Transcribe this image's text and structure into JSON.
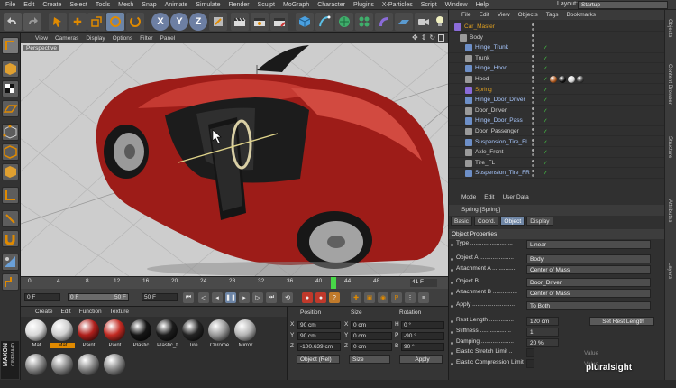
{
  "menubar": {
    "items": [
      "File",
      "Edit",
      "Create",
      "Select",
      "Tools",
      "Mesh",
      "Snap",
      "Animate",
      "Simulate",
      "Render",
      "Sculpt",
      "MoGraph",
      "Character",
      "Plugins",
      "X-Particles",
      "Script",
      "Window",
      "Help"
    ],
    "layout_label": "Layout:",
    "layout_value": "Startup"
  },
  "toolbar": {
    "icons": [
      "undo-icon",
      "redo-icon",
      "live-selection-icon",
      "move-icon",
      "scale-icon",
      "rotate-icon",
      "recent-tools-icon",
      "x-axis-icon",
      "y-axis-icon",
      "z-axis-icon",
      "world-coordinates-icon",
      "render-view-icon",
      "render-picture-viewer-icon",
      "edit-render-settings-icon",
      "cube-icon",
      "pen-spline-icon",
      "subdivision-surface-icon",
      "array-icon",
      "bend-deformer-icon",
      "floor-icon",
      "camera-icon",
      "light-icon"
    ],
    "x_label": "X",
    "y_label": "Y",
    "z_label": "Z"
  },
  "viewport": {
    "menu": [
      "View",
      "Cameras",
      "Display",
      "Options",
      "Filter",
      "Panel"
    ],
    "label": "Perspective"
  },
  "timeline": {
    "ticks": [
      "0",
      "4",
      "8",
      "12",
      "16",
      "20",
      "24",
      "28",
      "32",
      "36",
      "40",
      "44",
      "48"
    ],
    "current_frame_indicator": "41 F",
    "playhead_frame": 41
  },
  "transport": {
    "start_frame": "0 F",
    "preview_start": "0 F",
    "preview_end": "50 F",
    "end_frame": "50 F"
  },
  "materials": {
    "menu": [
      "Create",
      "Edit",
      "Function",
      "Texture"
    ],
    "items": [
      {
        "label": "Mat",
        "color": "#d8d8d8"
      },
      {
        "label": "Mat",
        "color": "#cfcfcf",
        "selected": true
      },
      {
        "label": "Paint",
        "color": "#b0201c"
      },
      {
        "label": "Paint",
        "color": "#c22a22"
      },
      {
        "label": "Plastic",
        "color": "#151515"
      },
      {
        "label": "Plastic_f",
        "color": "#1c1c1c"
      },
      {
        "label": "Tire",
        "color": "#242424"
      },
      {
        "label": "Chrome",
        "color": "#9a9a9a"
      },
      {
        "label": "Mirror",
        "color": "#b4b4b4"
      }
    ],
    "brand_top": "MAXON",
    "brand_bottom": "CINEMA4D"
  },
  "coordinates": {
    "headers": {
      "position": "Position",
      "size": "Size",
      "rotation": "Rotation"
    },
    "rows": [
      {
        "axis": "X",
        "pos": "90 cm",
        "size_axis": "X",
        "size": "0 cm",
        "rot_axis": "H",
        "rot": "0 °"
      },
      {
        "axis": "Y",
        "pos": "90 cm",
        "size_axis": "Y",
        "size": "0 cm",
        "rot_axis": "P",
        "rot": "-90 °"
      },
      {
        "axis": "Z",
        "pos": "-100.639 cm",
        "size_axis": "Z",
        "size": "0 cm",
        "rot_axis": "B",
        "rot": "90 °"
      }
    ],
    "mode_dropdown": "Object (Rel)",
    "size_dropdown": "Size",
    "apply_button": "Apply"
  },
  "objects": {
    "menu": [
      "File",
      "Edit",
      "View",
      "Objects",
      "Tags",
      "Bookmarks"
    ],
    "items": [
      {
        "name": "Car_Master",
        "indent": 0,
        "color": "#e0a020",
        "checks": false
      },
      {
        "name": "Body",
        "indent": 1,
        "color": "#cfcfcf",
        "checks": false
      },
      {
        "name": "Hinge_Trunk",
        "indent": 2,
        "color": "#a8c8ff",
        "checks": true
      },
      {
        "name": "Trunk",
        "indent": 2,
        "color": "#cfcfcf",
        "checks": true
      },
      {
        "name": "Hinge_Hood",
        "indent": 2,
        "color": "#a8c8ff",
        "checks": true
      },
      {
        "name": "Hood",
        "indent": 2,
        "color": "#cfcfcf",
        "checks": true,
        "tags": true
      },
      {
        "name": "Spring",
        "indent": 2,
        "color": "#e0a020",
        "checks": true
      },
      {
        "name": "Hinge_Door_Driver",
        "indent": 2,
        "color": "#a8c8ff",
        "checks": true
      },
      {
        "name": "Door_Driver",
        "indent": 2,
        "color": "#cfcfcf",
        "checks": true
      },
      {
        "name": "Hinge_Door_Pass",
        "indent": 2,
        "color": "#a8c8ff",
        "checks": true
      },
      {
        "name": "Door_Passenger",
        "indent": 2,
        "color": "#cfcfcf",
        "checks": true
      },
      {
        "name": "Suspension_Tire_FL",
        "indent": 2,
        "color": "#a8c8ff",
        "checks": true
      },
      {
        "name": "Axle_Front",
        "indent": 2,
        "color": "#cfcfcf",
        "checks": true
      },
      {
        "name": "Tire_FL",
        "indent": 2,
        "color": "#cfcfcf",
        "checks": true
      },
      {
        "name": "Suspension_Tire_FR",
        "indent": 2,
        "color": "#a8c8ff",
        "checks": true
      }
    ]
  },
  "attributes": {
    "menu": [
      "Mode",
      "Edit",
      "User Data"
    ],
    "title": "Spring [Spring]",
    "tabs": [
      "Basic",
      "Coord.",
      "Object",
      "Display"
    ],
    "active_tab": "Object",
    "section": "Object Properties",
    "rows": [
      {
        "label": "Type ..........................",
        "value": "Linear"
      },
      {
        "label": "Object A .....................",
        "value": "Body"
      },
      {
        "label": "Attachment A ...............",
        "value": "Center of Mass"
      },
      {
        "label": "Object B .....................",
        "value": "Door_Driver"
      },
      {
        "label": "Attachment B ...............",
        "value": "Center of Mass"
      },
      {
        "label": "Apply ..........................",
        "value": "To Both"
      },
      {
        "label": "Rest Length ...............",
        "value": "120 cm"
      },
      {
        "label": "Stiffness ...................",
        "value": "1"
      },
      {
        "label": "Damping ....................",
        "value": "20 %"
      },
      {
        "label": "Elastic Stretch Limit ..",
        "value": ""
      },
      {
        "label": "Elastic Compression Limit",
        "value": ""
      }
    ],
    "set_rest_length": "Set Rest Length",
    "value_label": "Value"
  },
  "right_tabs": [
    "Objects",
    "Content Browser",
    "Structure",
    "Attributes",
    "Layers"
  ],
  "watermark": "pluralsight"
}
